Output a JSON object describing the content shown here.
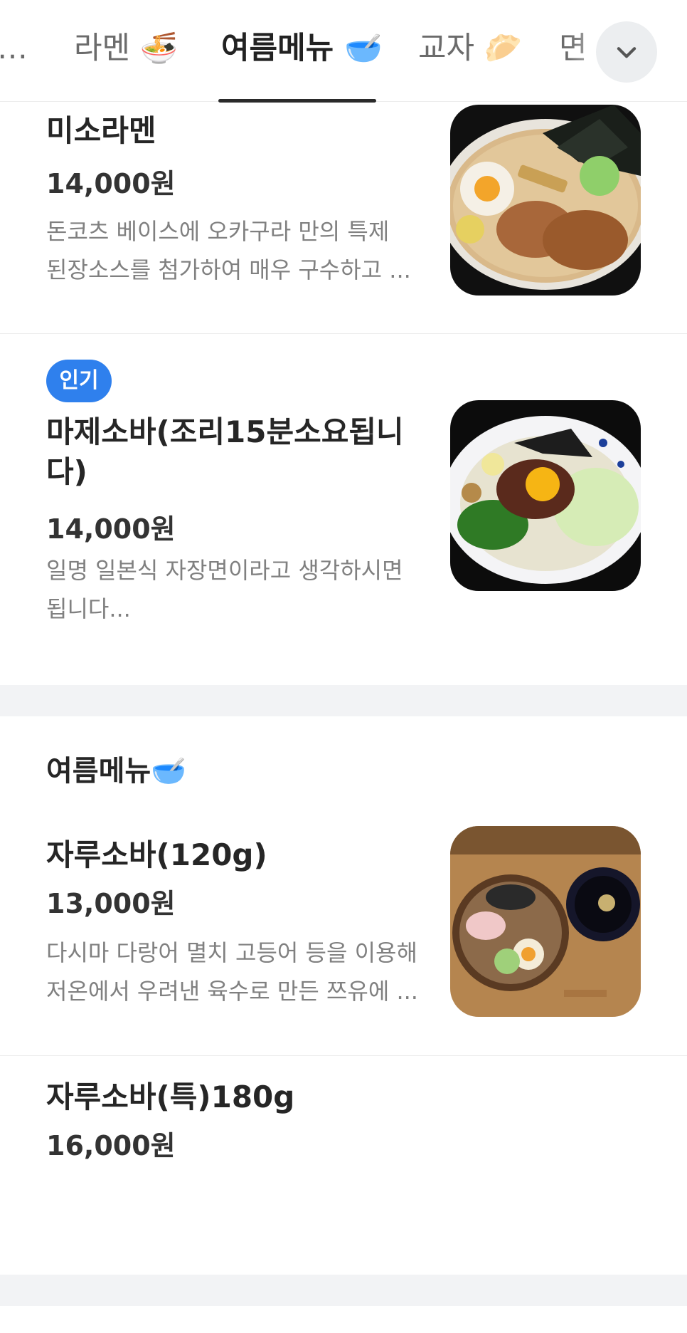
{
  "tabs": [
    {
      "label": "…",
      "emoji": ""
    },
    {
      "label": "라멘",
      "emoji": "🍜"
    },
    {
      "label": "여름메뉴",
      "emoji": "🥣"
    },
    {
      "label": "교자",
      "emoji": "🥟"
    },
    {
      "label": "면",
      "emoji": ""
    }
  ],
  "active_tab": "여름메뉴",
  "items": [
    {
      "name": "미소라멘",
      "price": "14,000원",
      "desc1": "돈코츠 베이스에 오카구라 만의 특제",
      "desc2": "된장소스를 첨가하여 매우 구수하고 ..."
    },
    {
      "badge": "인기",
      "name1": "마제소바(조리15분소요됩니",
      "name2": "다)",
      "price": "14,000원",
      "desc1": "일명 일본식 자장면이라고 생각하시면",
      "desc2": "됩니다..."
    }
  ],
  "section": {
    "title": "여름메뉴",
    "emoji": "🥣",
    "items": [
      {
        "name": "자루소바(120g)",
        "price": "13,000원",
        "desc1": "다시마 다랑어 멸치 고등어 등을 이용해",
        "desc2": "저온에서 우려낸 육수로 만든 쯔유에 ..."
      },
      {
        "name": "자루소바(특)180g",
        "price": "16,000원"
      }
    ]
  },
  "colors": {
    "badge": "#2f80ed",
    "gap": "#f2f3f5",
    "text": "#222222",
    "muted": "#808080"
  },
  "icons": {
    "dropdown": "chevron-down-icon"
  }
}
